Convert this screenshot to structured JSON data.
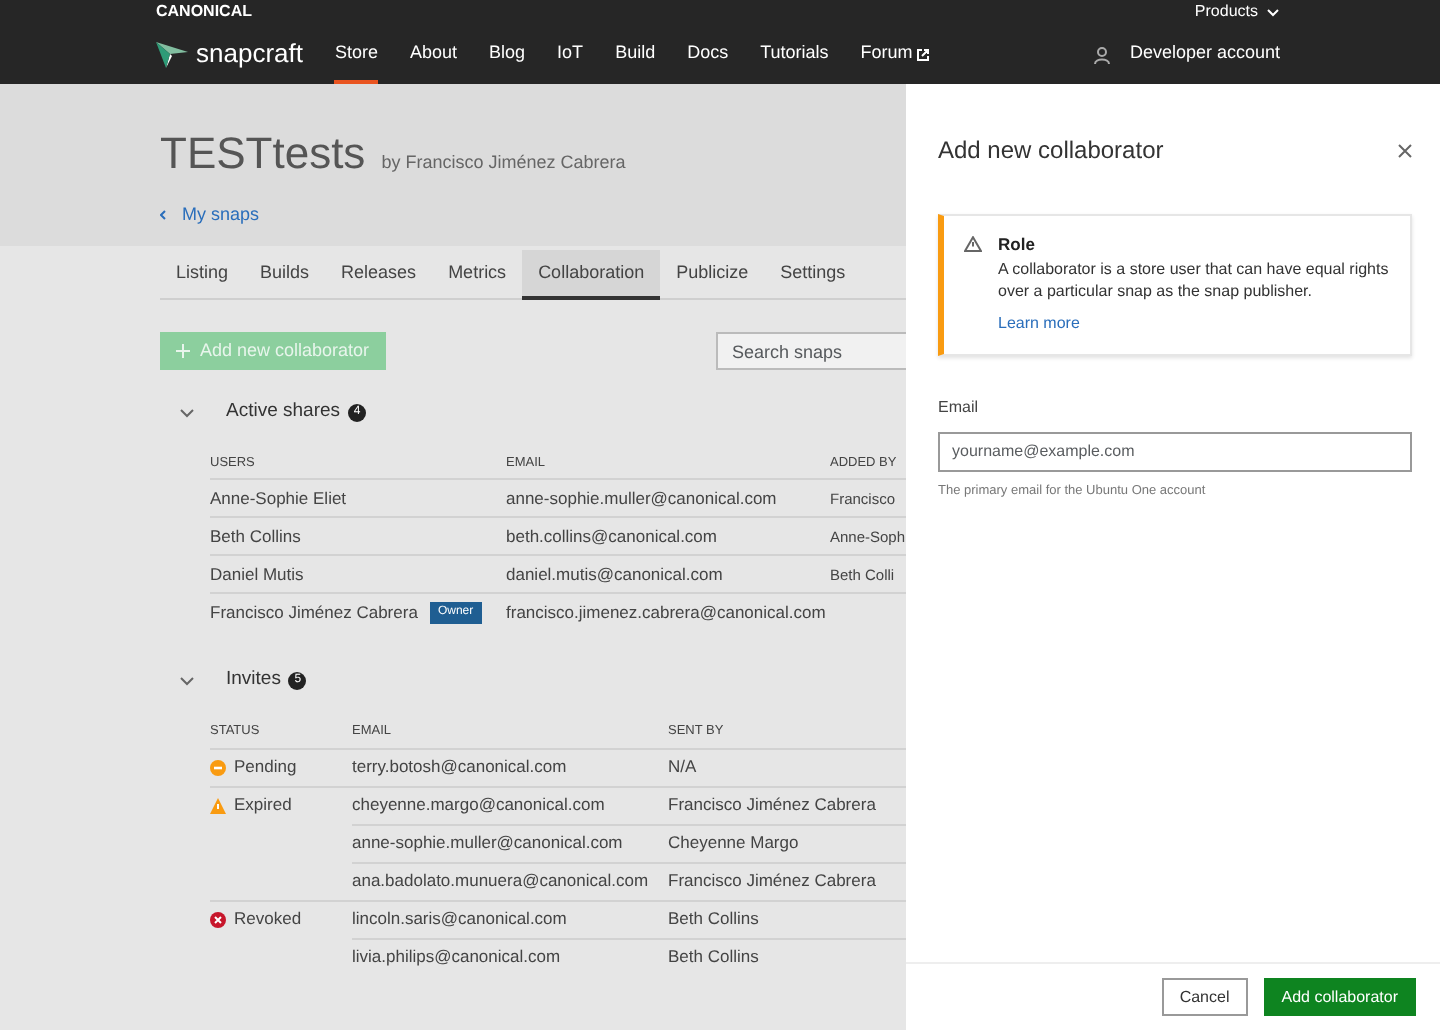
{
  "top_bar": {
    "brand": "CANONICAL",
    "products": "Products"
  },
  "nav": {
    "logo": "snapcraft",
    "items": [
      {
        "label": "Store",
        "selected": true,
        "external": false
      },
      {
        "label": "About",
        "selected": false,
        "external": false
      },
      {
        "label": "Blog",
        "selected": false,
        "external": false
      },
      {
        "label": "IoT",
        "selected": false,
        "external": false
      },
      {
        "label": "Build",
        "selected": false,
        "external": false
      },
      {
        "label": "Docs",
        "selected": false,
        "external": false
      },
      {
        "label": "Tutorials",
        "selected": false,
        "external": false
      },
      {
        "label": "Forum",
        "selected": false,
        "external": true
      }
    ],
    "account": "Developer account"
  },
  "snap": {
    "title": "TESTtests",
    "byline": "by Francisco Jiménez Cabrera",
    "back_link": "My snaps"
  },
  "tabs": [
    {
      "label": "Listing",
      "selected": false
    },
    {
      "label": "Builds",
      "selected": false
    },
    {
      "label": "Releases",
      "selected": false
    },
    {
      "label": "Metrics",
      "selected": false
    },
    {
      "label": "Collaboration",
      "selected": true
    },
    {
      "label": "Publicize",
      "selected": false
    },
    {
      "label": "Settings",
      "selected": false
    }
  ],
  "add_button": {
    "label": "Add new collaborator",
    "disabled": true
  },
  "search": {
    "placeholder": "Search snaps"
  },
  "active_shares": {
    "title": "Active shares",
    "count": "4",
    "expanded": true,
    "columns": [
      "USERS",
      "EMAIL",
      "ADDED BY"
    ],
    "rows": [
      {
        "user": "Anne-Sophie Eliet",
        "email": "anne-sophie.muller@canonical.com",
        "added_by": "Francisco"
      },
      {
        "user": "Beth Collins",
        "email": "beth.collins@canonical.com",
        "added_by": "Anne-Soph"
      },
      {
        "user": "Daniel Mutis",
        "email": "daniel.mutis@canonical.com",
        "added_by": "Beth Colli"
      },
      {
        "user": "Francisco Jiménez Cabrera",
        "badge": "Owner",
        "email": "francisco.jimenez.cabrera@canonical.com"
      }
    ]
  },
  "invites": {
    "title": "Invites",
    "count": "5",
    "expanded": true,
    "columns": [
      "STATUS",
      "EMAIL",
      "SENT BY"
    ],
    "rows": [
      {
        "kind": "pending",
        "status": "Pending",
        "email": "terry.botosh@canonical.com",
        "sent_by": "N/A"
      },
      {
        "kind": "expired",
        "status": "Expired",
        "email": "cheyenne.margo@canonical.com",
        "sent_by": "Francisco Jiménez Cabrera"
      },
      {
        "email": "anne-sophie.muller@canonical.com",
        "sent_by": "Cheyenne Margo"
      },
      {
        "email": "ana.badolato.munuera@canonical.com",
        "sent_by": "Francisco Jiménez Cabrera"
      },
      {
        "kind": "revoked",
        "status": "Revoked",
        "email": "lincoln.saris@canonical.com",
        "sent_by": "Beth Collins"
      },
      {
        "email": "livia.philips@canonical.com",
        "sent_by": "Beth Collins"
      }
    ]
  },
  "panel": {
    "title": "Add new collaborator",
    "notification": {
      "title": "Role",
      "text": "A collaborator is a store user that can have equal rights over a particular snap as the snap publisher.",
      "link": "Learn more"
    },
    "email": {
      "label": "Email",
      "placeholder": "yourname@example.com",
      "help": "The primary email for the Ubuntu One account"
    },
    "buttons": [
      {
        "label": "Cancel",
        "kind": "secondary"
      },
      {
        "label": "Add collaborator",
        "kind": "primary"
      }
    ]
  }
}
